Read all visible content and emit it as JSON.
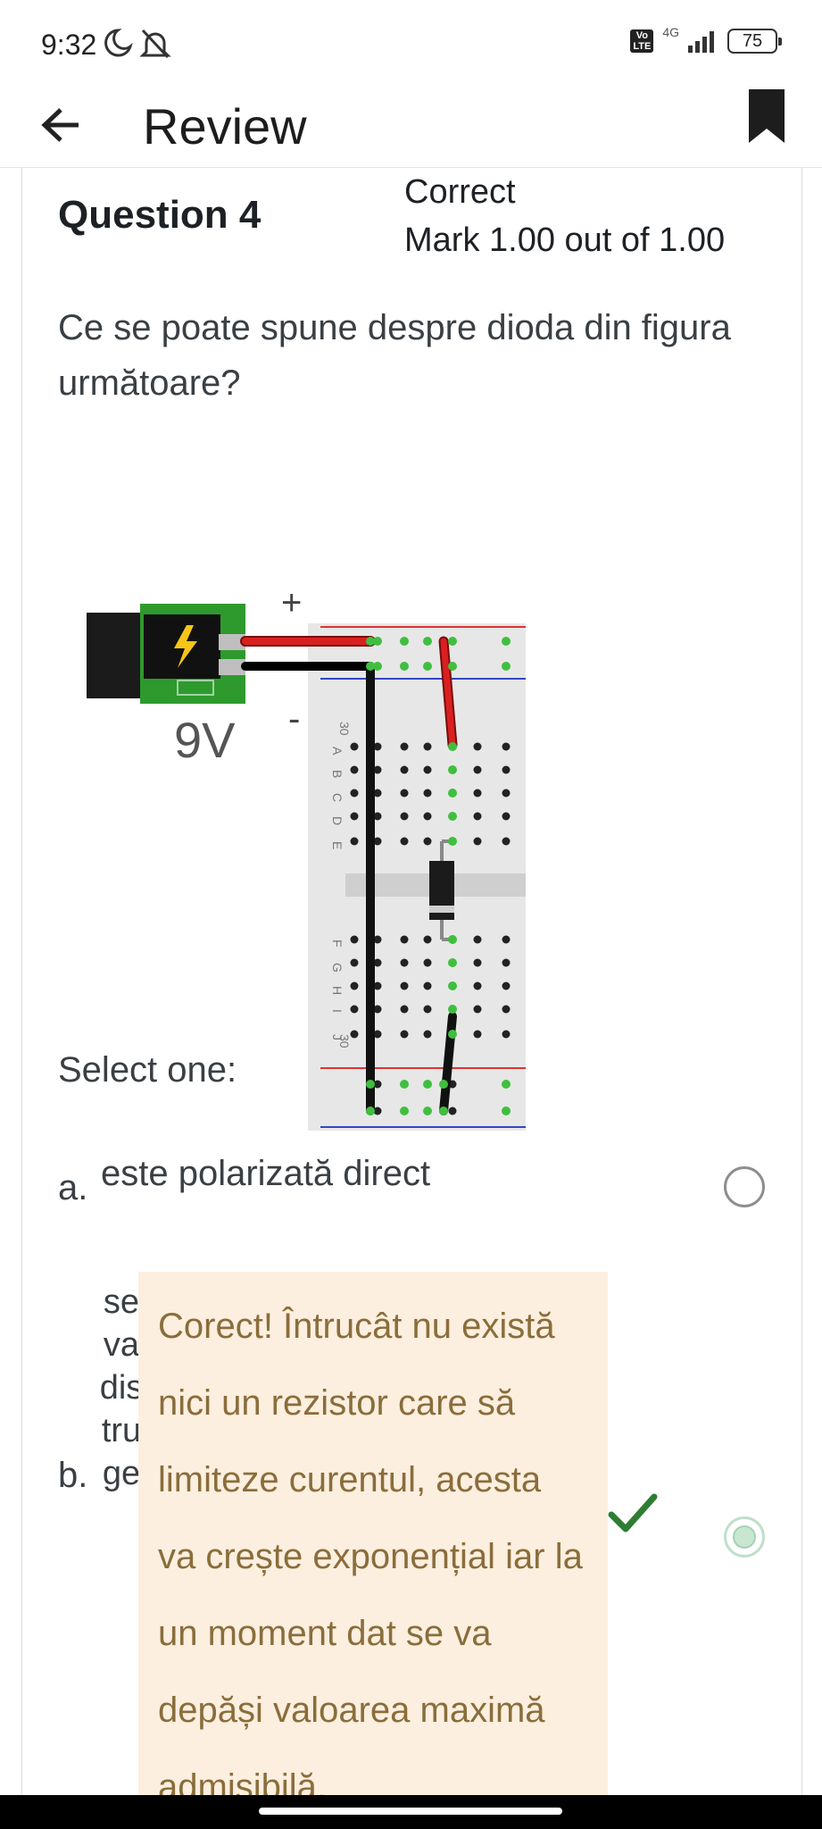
{
  "status_bar": {
    "time": "9:32",
    "volte_line1": "Vo",
    "volte_line2": "LTE",
    "network": "4G",
    "battery": "75"
  },
  "app_bar": {
    "title": "Review"
  },
  "question": {
    "title": "Question 4",
    "state": "Correct",
    "mark": "Mark 1.00 out of 1.00",
    "text": "Ce se poate spune despre dioda din figura următoare?"
  },
  "figure": {
    "plus": "+",
    "minus": "-",
    "voltage": "9V",
    "row_top": "30",
    "row_bottom": "30",
    "col_letters": [
      "A",
      "B",
      "C",
      "D",
      "E",
      "F",
      "G",
      "H",
      "I",
      "J"
    ]
  },
  "answer": {
    "prompt": "Select one:",
    "options": [
      {
        "letter": "a.",
        "text": "este polarizată direct",
        "selected": false
      },
      {
        "letter": "b.",
        "text": "se va distruge",
        "selected": true
      }
    ],
    "feedback": "Corect! Întrucât nu există nici un rezistor care să limiteze curentul, acesta va crește exponențial iar la un moment dat se va depăși valoarea maximă admisibilă."
  },
  "colors": {
    "feedback_bg": "#fcefdf",
    "feedback_text": "#8a6d3b",
    "correct_green": "#2e7d32"
  }
}
